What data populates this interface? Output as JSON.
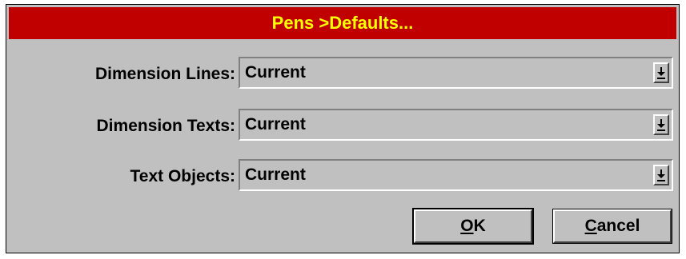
{
  "dialog": {
    "title": "Pens >Defaults...",
    "colors": {
      "titlebar": "#c00000",
      "title_text": "#ffff00",
      "face": "#c0c0c0"
    }
  },
  "fields": [
    {
      "label": "Dimension Lines:",
      "value": "Current",
      "icon": "dropdown-arrow-icon"
    },
    {
      "label": "Dimension Texts:",
      "value": "Current",
      "icon": "dropdown-arrow-icon"
    },
    {
      "label": "Text Objects:",
      "value": "Current",
      "icon": "dropdown-arrow-icon"
    }
  ],
  "buttons": {
    "ok": {
      "mnemonic": "O",
      "rest": "K"
    },
    "cancel": {
      "mnemonic": "C",
      "rest": "ancel"
    }
  }
}
